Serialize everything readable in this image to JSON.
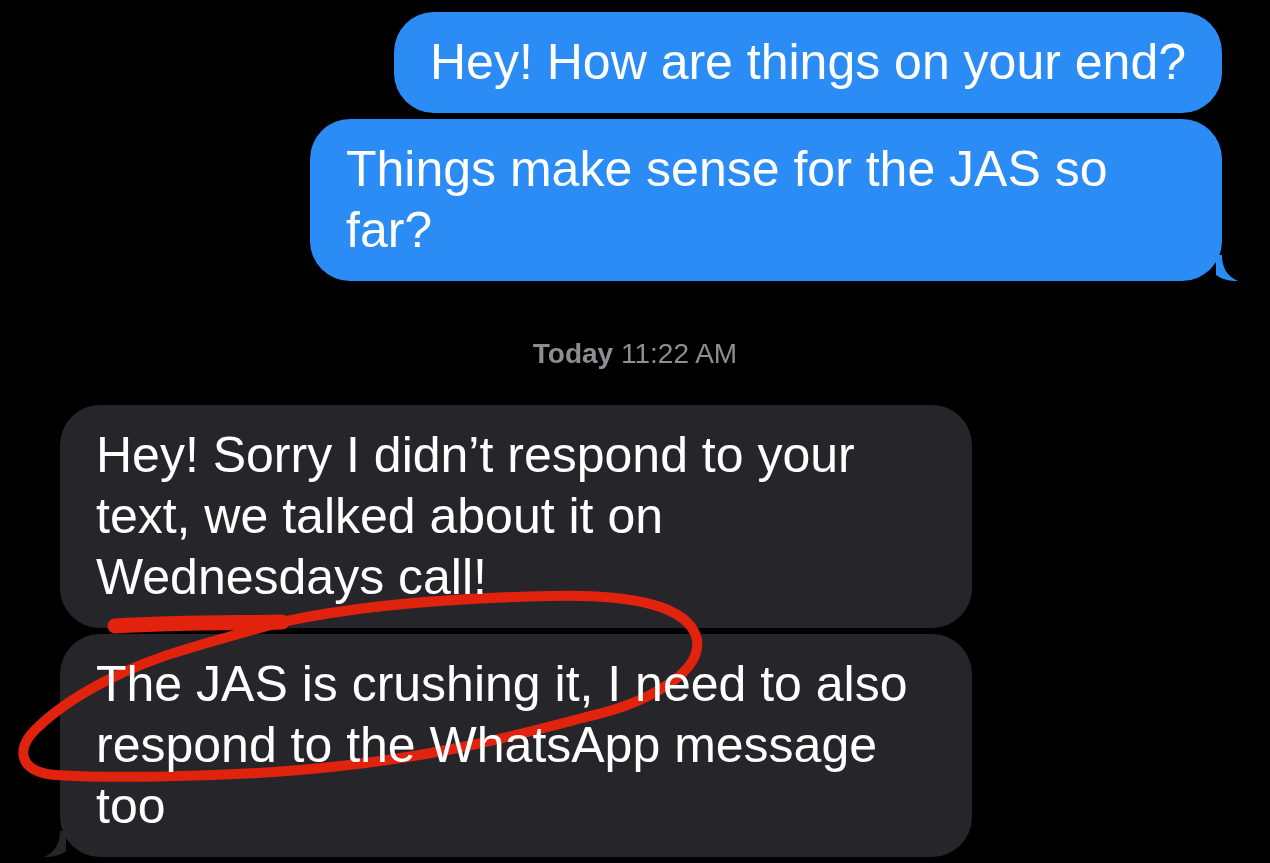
{
  "thread": [
    {
      "kind": "sent",
      "text": "Hey! How are things on your end?",
      "tail": false
    },
    {
      "kind": "sent",
      "text": "Things make sense for the JAS so far?",
      "tail": true
    },
    {
      "kind": "timestamp",
      "text": "**Today** 11:22 AM"
    },
    {
      "kind": "received",
      "text": "Hey! Sorry I didn’t respond to your text, we talked about it on Wednesdays call!",
      "tail": false
    },
    {
      "kind": "received",
      "text": "The JAS is crushing it, I need to also respond to the WhatsApp message too",
      "tail": true
    }
  ]
}
